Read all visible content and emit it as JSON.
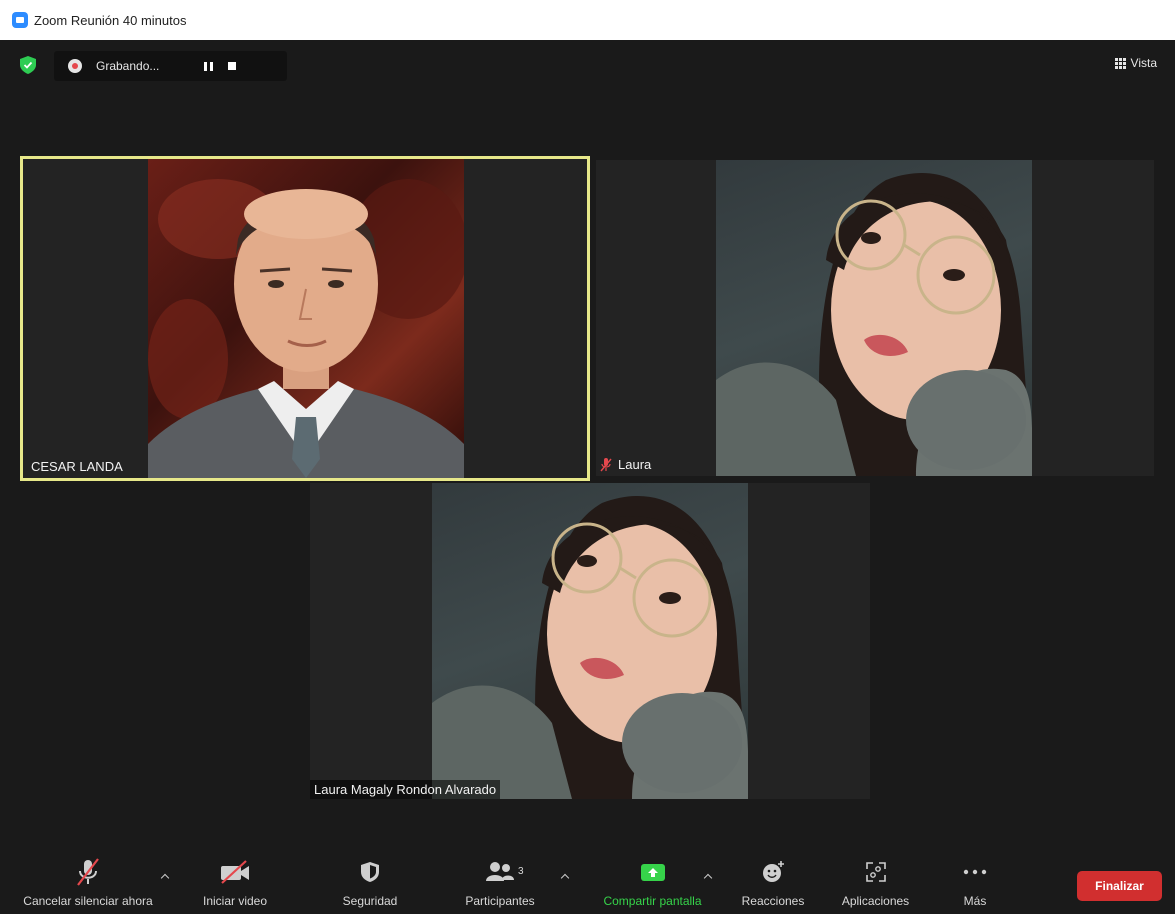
{
  "window": {
    "title": "Zoom Reunión 40 minutos"
  },
  "recording": {
    "status": "Grabando..."
  },
  "header": {
    "view_label": "Vista"
  },
  "participants": [
    {
      "name": "CESAR LANDA",
      "active_speaker": true,
      "muted": false
    },
    {
      "name": "Laura",
      "active_speaker": false,
      "muted": true
    },
    {
      "name": "Laura Magaly Rondon Alvarado",
      "active_speaker": false,
      "muted": false
    }
  ],
  "toolbar": {
    "unmute": "Cancelar silenciar ahora",
    "start_video": "Iniciar video",
    "security": "Seguridad",
    "participants": "Participantes",
    "participants_count": "3",
    "share_screen": "Compartir pantalla",
    "reactions": "Reacciones",
    "apps": "Aplicaciones",
    "more": "Más",
    "end": "Finalizar"
  },
  "colors": {
    "active_speaker_border": "#e7e88a",
    "share_green": "#36d34a",
    "end_red": "#d12f2f",
    "muted_red": "#e5484d"
  }
}
